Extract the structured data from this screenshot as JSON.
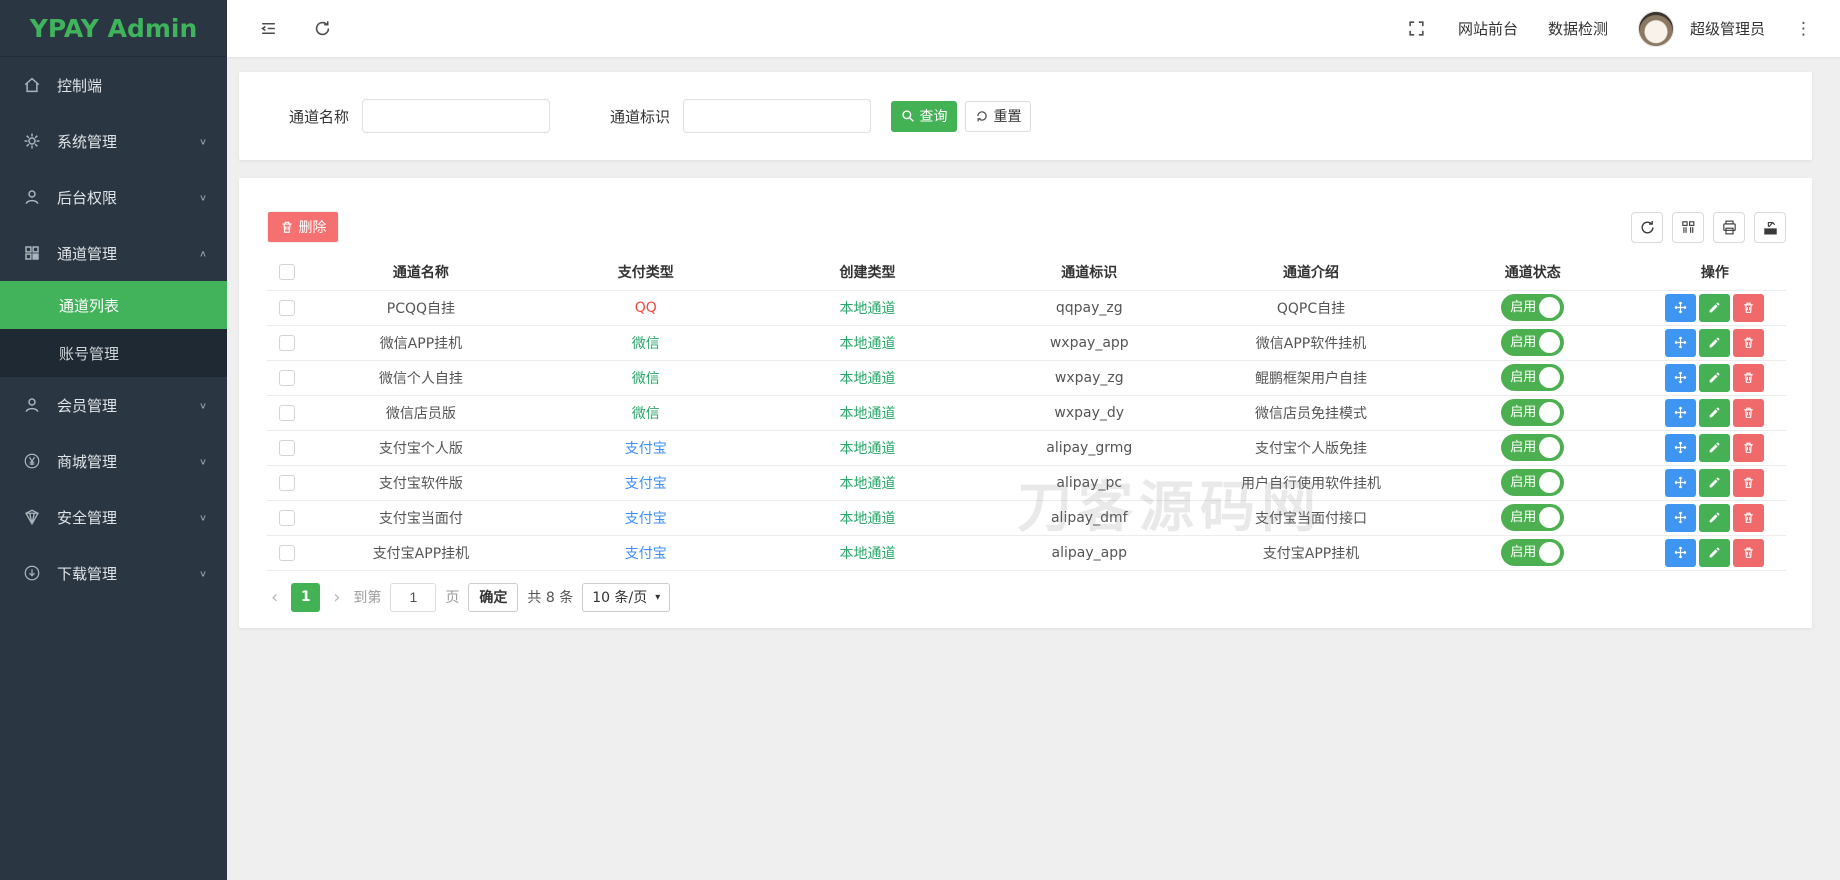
{
  "brand": {
    "name": "YPAY Admin"
  },
  "colors": {
    "accent_green": "#43b254",
    "sidebar_bg": "#2a3642",
    "submenu_bg": "#1f2933",
    "active_item_green": "#42b25b",
    "qq_red": "#f5493d",
    "wechat_green": "#2aa76a",
    "alipay_blue": "#3e8ef7",
    "local_channel_green": "#2aa76a",
    "delete_button_red": "#f57070",
    "status_pill_green": "#4cb050",
    "action_blue": "#3f95f2",
    "action_green": "#45b054",
    "action_red": "#f0696b"
  },
  "topbar": {
    "site_front": "网站前台",
    "data_check": "数据检测",
    "username": "超级管理员"
  },
  "sidebar": {
    "items": [
      {
        "id": "control",
        "icon": "home",
        "label": "控制端",
        "chevron": null
      },
      {
        "id": "system",
        "icon": "gear",
        "label": "系统管理",
        "chevron": "down"
      },
      {
        "id": "permission",
        "icon": "user",
        "label": "后台权限",
        "chevron": "down"
      },
      {
        "id": "channel",
        "icon": "grid",
        "label": "通道管理",
        "chevron": "up",
        "submenu": [
          {
            "id": "channel-list",
            "label": "通道列表",
            "active": true
          },
          {
            "id": "account-manage",
            "label": "账号管理",
            "active": false
          }
        ]
      },
      {
        "id": "member",
        "icon": "user",
        "label": "会员管理",
        "chevron": "down"
      },
      {
        "id": "mall",
        "icon": "yen",
        "label": "商城管理",
        "chevron": "down"
      },
      {
        "id": "security",
        "icon": "shield",
        "label": "安全管理",
        "chevron": "down"
      },
      {
        "id": "download",
        "icon": "download",
        "label": "下载管理",
        "chevron": "down"
      }
    ]
  },
  "search": {
    "name_label": "通道名称",
    "name_value": "",
    "code_label": "通道标识",
    "code_value": "",
    "query_label": "查询",
    "reset_label": "重置"
  },
  "toolbar": {
    "delete_label": "删除"
  },
  "table": {
    "columns": [
      "通道名称",
      "支付类型",
      "创建类型",
      "通道标识",
      "通道介绍",
      "通道状态",
      "操作"
    ],
    "rows": [
      {
        "name": "PCQQ自挂",
        "pay_type": "QQ",
        "pay_color": "red",
        "create_type": "本地通道",
        "code": "qqpay_zg",
        "desc": "QQPC自挂",
        "status": "启用"
      },
      {
        "name": "微信APP挂机",
        "pay_type": "微信",
        "pay_color": "green",
        "create_type": "本地通道",
        "code": "wxpay_app",
        "desc": "微信APP软件挂机",
        "status": "启用"
      },
      {
        "name": "微信个人自挂",
        "pay_type": "微信",
        "pay_color": "green",
        "create_type": "本地通道",
        "code": "wxpay_zg",
        "desc": "鲲鹏框架用户自挂",
        "status": "启用"
      },
      {
        "name": "微信店员版",
        "pay_type": "微信",
        "pay_color": "green",
        "create_type": "本地通道",
        "code": "wxpay_dy",
        "desc": "微信店员免挂模式",
        "status": "启用"
      },
      {
        "name": "支付宝个人版",
        "pay_type": "支付宝",
        "pay_color": "blue",
        "create_type": "本地通道",
        "code": "alipay_grmg",
        "desc": "支付宝个人版免挂",
        "status": "启用"
      },
      {
        "name": "支付宝软件版",
        "pay_type": "支付宝",
        "pay_color": "blue",
        "create_type": "本地通道",
        "code": "alipay_pc",
        "desc": "用户自行使用软件挂机",
        "status": "启用"
      },
      {
        "name": "支付宝当面付",
        "pay_type": "支付宝",
        "pay_color": "blue",
        "create_type": "本地通道",
        "code": "alipay_dmf",
        "desc": "支付宝当面付接口",
        "status": "启用"
      },
      {
        "name": "支付宝APP挂机",
        "pay_type": "支付宝",
        "pay_color": "blue",
        "create_type": "本地通道",
        "code": "alipay_app",
        "desc": "支付宝APP挂机",
        "status": "启用"
      }
    ]
  },
  "pagination": {
    "prev": "‹",
    "next": "›",
    "current_page": "1",
    "goto_prefix": "到第",
    "goto_value": "1",
    "goto_suffix": "页",
    "confirm_label": "确定",
    "total_label": "共 8 条",
    "per_page_label": "10 条/页"
  },
  "watermark": "刀客源码网"
}
